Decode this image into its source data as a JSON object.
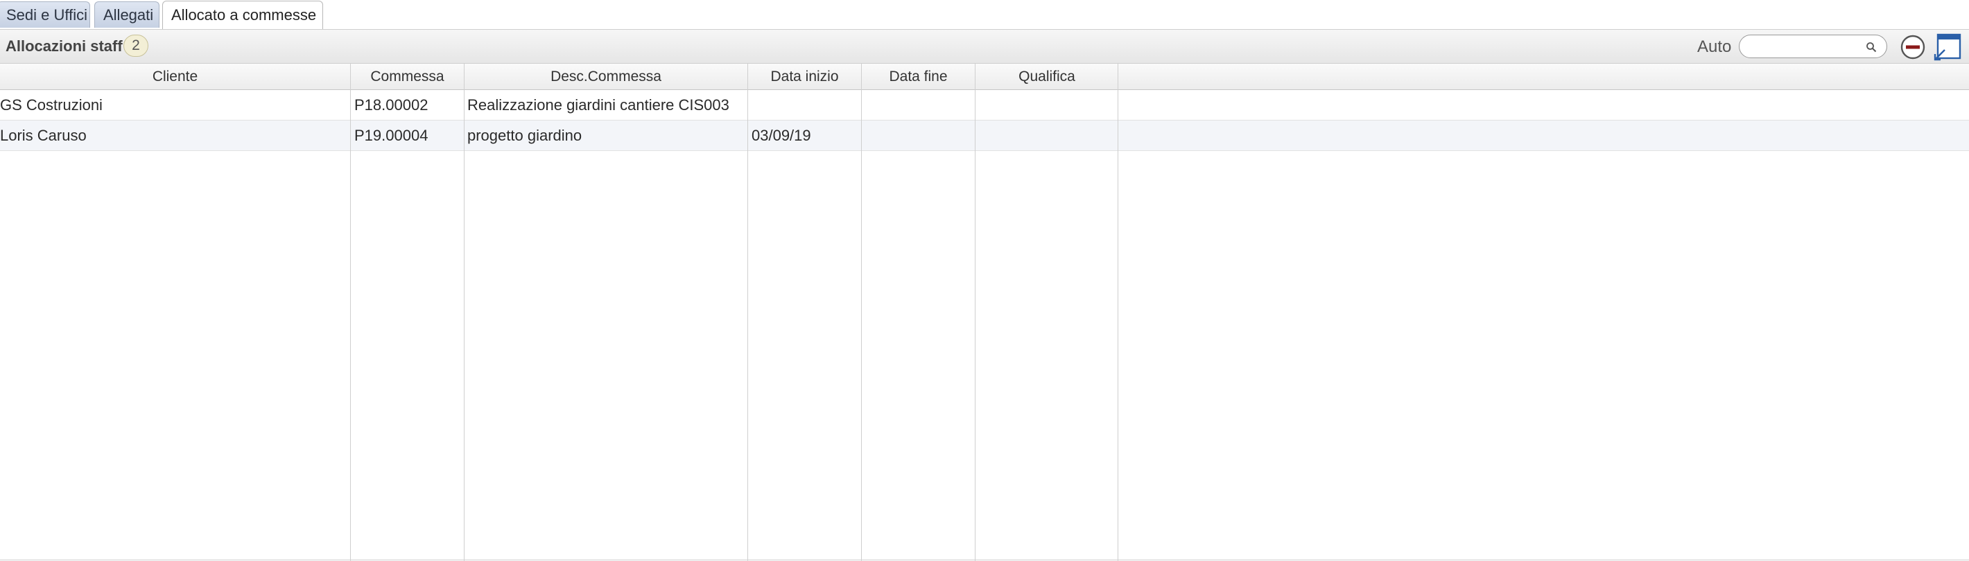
{
  "tabs": [
    {
      "label": "Sedi e Uffici"
    },
    {
      "label": "Allegati"
    },
    {
      "label": "Allocato a commesse"
    }
  ],
  "panel": {
    "title": "Allocazioni staff",
    "count": "2",
    "auto_label": "Auto",
    "search_value": "",
    "search_icon": "search-icon",
    "remove_icon": "minus-circle-icon",
    "window_icon": "window-icon"
  },
  "table": {
    "columns": [
      "Cliente",
      "Commessa",
      "Desc.Commessa",
      "Data inizio",
      "Data fine",
      "Qualifica"
    ],
    "rows": [
      {
        "cliente": "GS Costruzioni",
        "commessa": "P18.00002",
        "desc": "Realizzazione giardini cantiere CIS003",
        "data_inizio": "",
        "data_fine": "",
        "qualifica": ""
      },
      {
        "cliente": "Loris Caruso",
        "commessa": "P19.00004",
        "desc": "progetto giardino",
        "data_inizio": "03/09/19",
        "data_fine": "",
        "qualifica": ""
      }
    ]
  },
  "colors": {
    "tab_bg": "#c6d1e3",
    "header_bg": "#e6e6e6",
    "alt_row_bg": "#f3f5f9",
    "minus_icon_color": "#8b1a1a",
    "window_icon_color": "#2a5fa8"
  }
}
